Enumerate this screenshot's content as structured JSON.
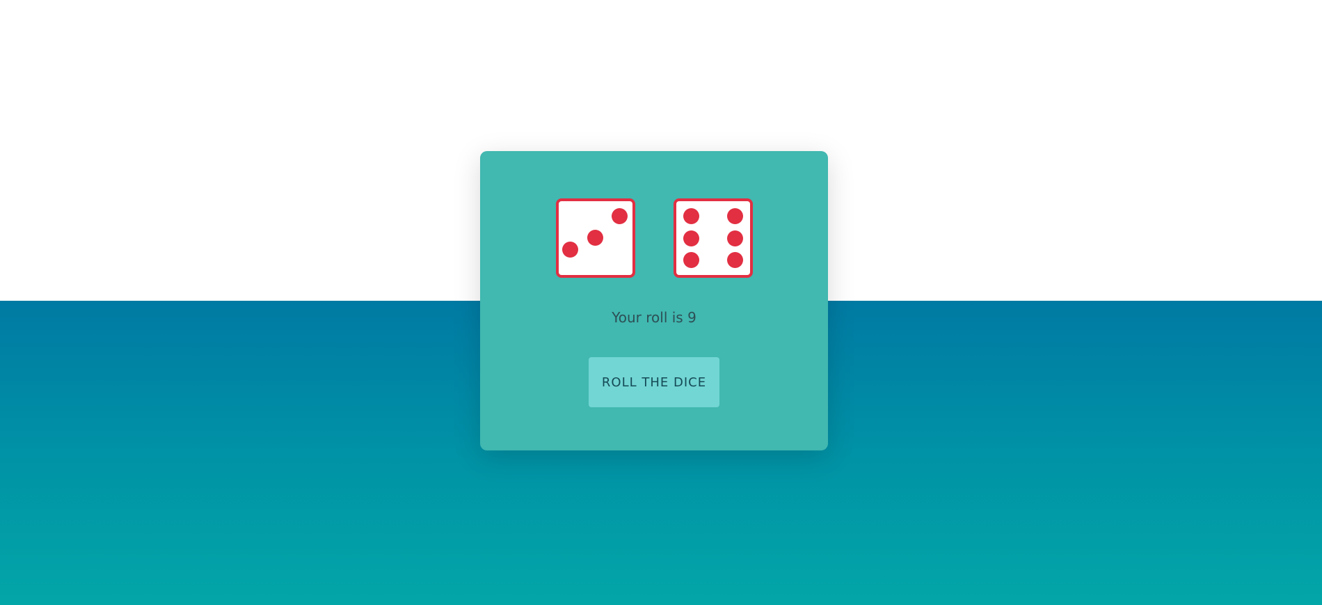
{
  "dice": [
    {
      "value": 3,
      "pip_color": "#e22f42"
    },
    {
      "value": 6,
      "pip_color": "#e22f42"
    }
  ],
  "result": {
    "text": "Your roll is 9"
  },
  "button": {
    "label": "ROLL THE DICE"
  },
  "colors": {
    "card": "#41b8b0",
    "button": "#72d6d4",
    "die_border": "#e22f42",
    "gradient_top": "#007aa3",
    "gradient_bottom": "#03a6a8"
  }
}
